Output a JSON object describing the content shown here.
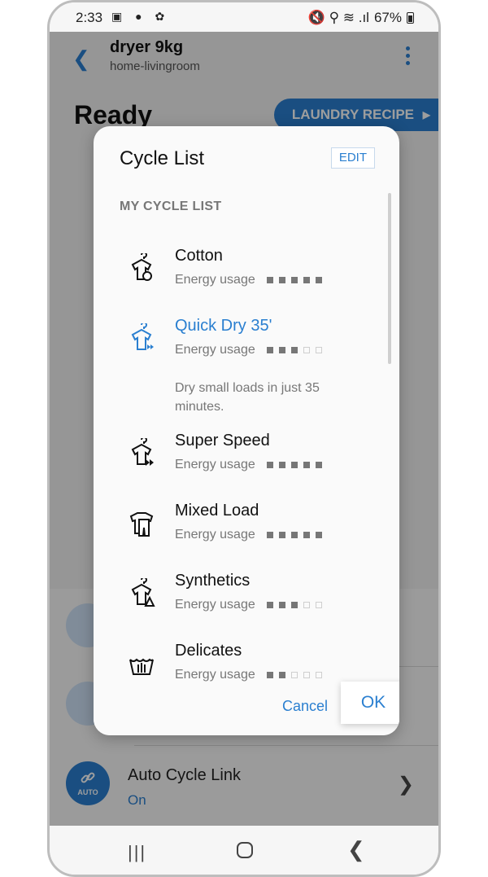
{
  "status_bar": {
    "time": "2:33",
    "left_icons": "▣ ● ✿",
    "right_icons": "🔇 ⚲ ≋ .ıl",
    "battery": "67%"
  },
  "header": {
    "device_name": "dryer 9kg",
    "room": "home-livingroom"
  },
  "main": {
    "status": "Ready",
    "recipe_button": "LAUNDRY RECIPE"
  },
  "background_list": {
    "auto_link_label": "Auto Cycle Link",
    "auto_link_status": "On",
    "auto_badge": "AUTO"
  },
  "dialog": {
    "title": "Cycle List",
    "edit_label": "EDIT",
    "section_label": "MY CYCLE LIST",
    "energy_label": "Energy usage",
    "cycles": [
      {
        "name": "Cotton",
        "icon": "shirt-cotton-icon",
        "energy_level": 5,
        "selected": false
      },
      {
        "name": "Quick Dry 35'",
        "icon": "quick-dry-icon",
        "energy_level": 3,
        "selected": true,
        "description": "Dry small loads in just 35 minutes."
      },
      {
        "name": "Super Speed",
        "icon": "super-speed-icon",
        "energy_level": 5,
        "selected": false
      },
      {
        "name": "Mixed Load",
        "icon": "mixed-load-icon",
        "energy_level": 5,
        "selected": false
      },
      {
        "name": "Synthetics",
        "icon": "synthetics-icon",
        "energy_level": 3,
        "selected": false
      },
      {
        "name": "Delicates",
        "icon": "delicates-icon",
        "energy_level": 2,
        "selected": false
      }
    ],
    "cancel_label": "Cancel",
    "ok_label": "OK"
  },
  "colors": {
    "accent": "#2a7fd0",
    "scrim": "rgba(0,0,0,0.38)"
  }
}
